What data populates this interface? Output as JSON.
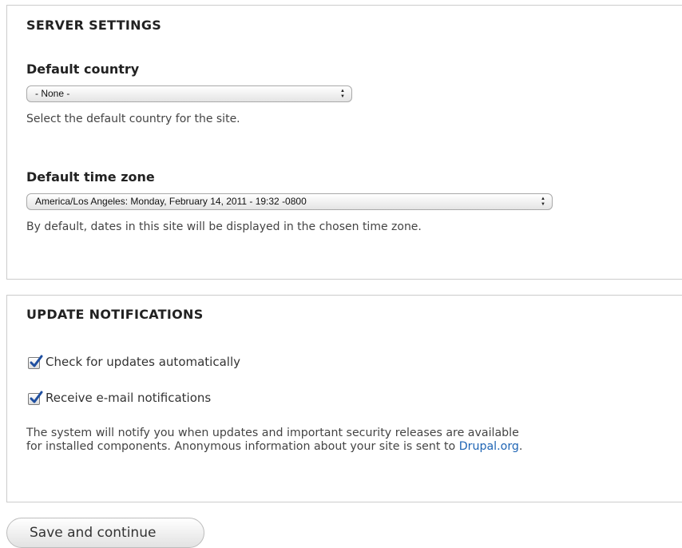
{
  "server_settings": {
    "legend": "SERVER SETTINGS",
    "country": {
      "label": "Default country",
      "selected": "- None -",
      "description": "Select the default country for the site."
    },
    "timezone": {
      "label": "Default time zone",
      "selected": "America/Los Angeles: Monday, February 14, 2011 - 19:32 -0800",
      "description": "By default, dates in this site will be displayed in the chosen time zone."
    }
  },
  "update_notifications": {
    "legend": "UPDATE NOTIFICATIONS",
    "check_updates": {
      "label": "Check for updates automatically",
      "checked": true
    },
    "email_notifications": {
      "label": "Receive e-mail notifications",
      "checked": true
    },
    "description_line1": "The system will notify you when updates and important security releases are available",
    "description_line2": "for installed components. Anonymous information about your site is sent to ",
    "link_text": "Drupal.org",
    "description_end": "."
  },
  "actions": {
    "save_label": "Save and continue"
  },
  "icons": {
    "select_arrows": "up-down-arrows-icon",
    "checkmark": "checkmark-icon"
  },
  "colors": {
    "link": "#1e64b4",
    "checkmark": "#1f4fa0"
  }
}
